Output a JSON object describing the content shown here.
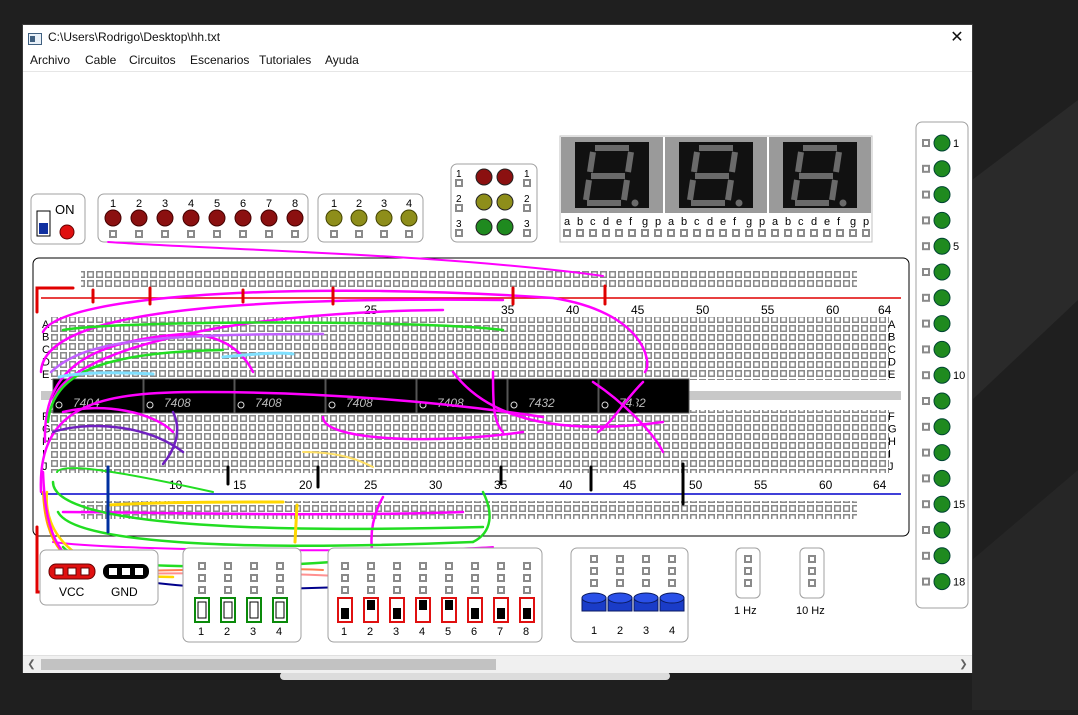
{
  "window": {
    "title": "C:\\Users\\Rodrigo\\Desktop\\hh.txt",
    "close": "✕"
  },
  "menu": [
    "Archivo",
    "Cable",
    "Circuitos",
    "Escenarios",
    "Tutoriales",
    "Ayuda"
  ],
  "power": {
    "label": "ON"
  },
  "leds_red": [
    "1",
    "2",
    "3",
    "4",
    "5",
    "6",
    "7",
    "8"
  ],
  "leds_olive": [
    "1",
    "2",
    "3",
    "4"
  ],
  "led_matrix": {
    "left": [
      "1",
      "2",
      "3"
    ],
    "right": [
      "1",
      "2",
      "3"
    ]
  },
  "display_segments": [
    "a",
    "b",
    "c",
    "d",
    "e",
    "f",
    "g",
    "p"
  ],
  "breadboard": {
    "top_numbers": [
      "35",
      "40",
      "45",
      "50",
      "55",
      "60",
      "64"
    ],
    "top_partial": "25",
    "bottom_numbers": [
      "10",
      "15",
      "20",
      "25",
      "30",
      "35",
      "40",
      "45",
      "50",
      "55",
      "60",
      "64"
    ],
    "rows_top": [
      "A",
      "B",
      "C",
      "D",
      "E"
    ],
    "rows_bottom": [
      "F",
      "G",
      "H",
      "I",
      "J"
    ]
  },
  "chips": [
    "7404",
    "7408",
    "7408",
    "7408",
    "7408",
    "7432",
    "7432"
  ],
  "power_block": {
    "vcc": "VCC",
    "gnd": "GND"
  },
  "switches_a": [
    "1",
    "2",
    "3",
    "4"
  ],
  "switches_b": [
    "1",
    "2",
    "3",
    "4",
    "5",
    "6",
    "7",
    "8"
  ],
  "buttons": [
    "1",
    "2",
    "3",
    "4"
  ],
  "clocks": [
    "1 Hz",
    "10 Hz"
  ],
  "right_leds": {
    "labels": [
      "1",
      "5",
      "10",
      "15",
      "18"
    ]
  },
  "colors": {
    "led_red": "#8b1010",
    "led_olive": "#8e8e1a",
    "led_green": "#1f8a1f",
    "wire_magenta": "#ff00ff",
    "wire_green": "#22dd22",
    "rail_red": "#e00000",
    "rail_blue": "#0000cc",
    "button_blue": "#1a3cc8"
  }
}
